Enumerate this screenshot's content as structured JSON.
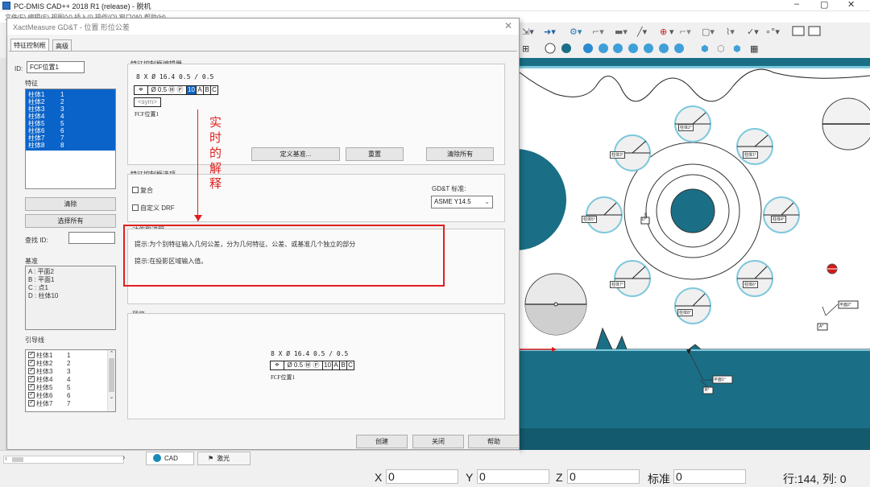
{
  "app": {
    "title": "PC-DMIS CAD++ 2018 R1 (release) - 脱机",
    "menu_partial": "文件(F)  编辑(E)  视图(V)  插入(I)  操作(O)  窗口(W)  帮助(H)"
  },
  "window_controls": {
    "minimize": "–",
    "maximize": "▢",
    "close": "✕"
  },
  "dialog": {
    "title": "XactMeasure GD&T - 位置 形位公差",
    "tabs": [
      "特征控制框",
      "高级"
    ],
    "id_label": "ID:",
    "id_value": "FCF位置1",
    "features_label": "特征",
    "features": [
      {
        "name": "柱体1",
        "n": "1"
      },
      {
        "name": "柱体2",
        "n": "2"
      },
      {
        "name": "柱体3",
        "n": "3"
      },
      {
        "name": "柱体4",
        "n": "4"
      },
      {
        "name": "柱体5",
        "n": "5"
      },
      {
        "name": "柱体6",
        "n": "6"
      },
      {
        "name": "柱体7",
        "n": "7"
      },
      {
        "name": "柱体8",
        "n": "8"
      }
    ],
    "clear_btn": "清除",
    "select_all_btn": "选择所有",
    "find_id_label": "查找 ID:",
    "datum_label": "基准",
    "datums": [
      "A : 平面2",
      "B : 平面1",
      "C : 点1",
      "D : 柱体10"
    ],
    "leader_label": "引导线",
    "leaders": [
      {
        "name": "柱体1",
        "n": "1"
      },
      {
        "name": "柱体2",
        "n": "2"
      },
      {
        "name": "柱体3",
        "n": "3"
      },
      {
        "name": "柱体4",
        "n": "4"
      },
      {
        "name": "柱体5",
        "n": "5"
      },
      {
        "name": "柱体6",
        "n": "6"
      },
      {
        "name": "柱体7",
        "n": "7"
      }
    ],
    "editor_label": "特征控制框编辑器",
    "fcf_header": "8 X Ø 16.4 0.5 / 0.5",
    "fcf": {
      "symbol": "⌖",
      "tol": "Ø 0.5 Ⓜ Ⓟ",
      "value": "10",
      "a": "A",
      "b": "B",
      "c": "C"
    },
    "sym_placeholder": "<sym>",
    "fcf_name": "FCF位置1",
    "define_datum_btn": "定义基准...",
    "reset_btn": "重置",
    "clear_all_btn": "清除所有",
    "options_label": "特征控制框选项",
    "composite_label": "复合",
    "custom_drf_label": "自定义 DRF",
    "gdt_standard_label": "GD&T 标准:",
    "gdt_standard_value": "ASME Y14.5",
    "actions_label": "动作和进程",
    "hint1": "提示:为个别特征输入几何公差，分为几何特征、公差、或基准几个独立的部分",
    "hint2": "提示:在投影区域输入值。",
    "annotation": "实时的解释",
    "preview_label": "预览",
    "preview_header": "8 X Ø 16.4 0.5 / 0.5",
    "preview_tol": "Ø 0.5 Ⓜ Ⓟ",
    "create_btn": "创建",
    "close_btn": "关闭",
    "help_btn": "帮助",
    "close_x": "✕"
  },
  "cad": {
    "hole_labels": [
      "柱体2°",
      "柱体3°",
      "柱体1°",
      "柱体5°",
      "柱体4°",
      "柱体7°",
      "柱体6°",
      "柱体8°"
    ],
    "tag_d": "D°",
    "tag_plane2": "平面2°",
    "tag_a": "A°",
    "tag_plane1": "平面1°",
    "tag_b": "B°"
  },
  "bottom_tabs": {
    "cad": "CAD",
    "light": "激光"
  },
  "status": {
    "x_label": "X",
    "x_val": "0",
    "y_label": "Y",
    "y_val": "0",
    "z_label": "Z",
    "z_val": "0",
    "std_label": "标准",
    "std_val": "0",
    "rowcol": "行:144, 列: 0"
  },
  "colors": {
    "selection": "#0a63c9",
    "annotation_red": "#e02020",
    "cad_teal": "#1a6f86",
    "hole_ring": "#7ec8dc"
  }
}
